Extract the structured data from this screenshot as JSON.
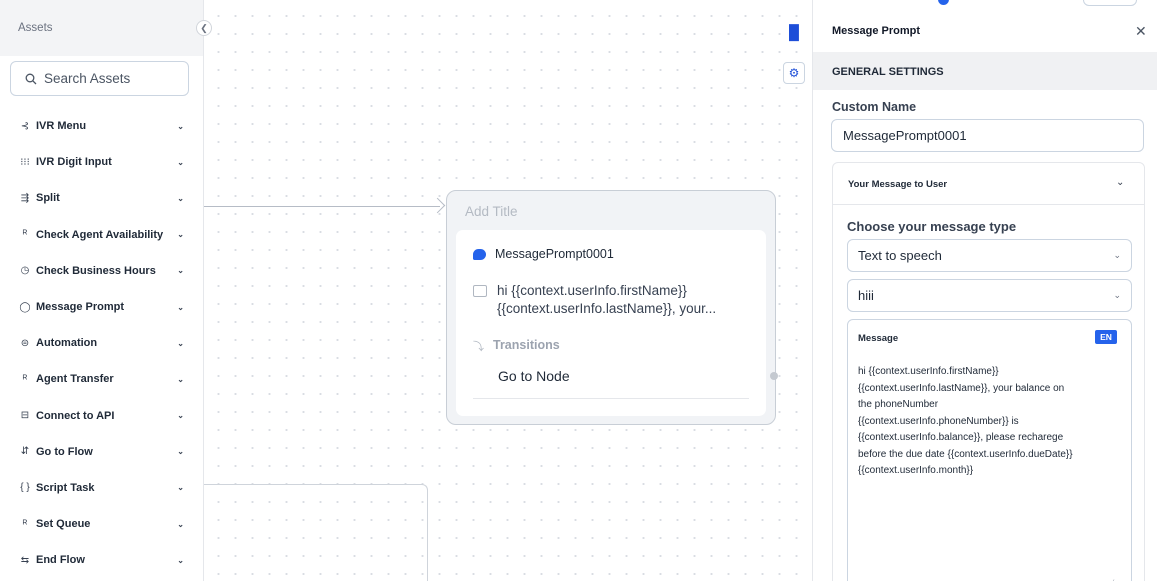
{
  "sidebar": {
    "title": "Assets",
    "collapse_icon": "chevron-left-icon",
    "search_placeholder": "Search Assets",
    "items": [
      {
        "label": "IVR Menu",
        "icon": "ivr-menu-icon",
        "glyph": "⊰"
      },
      {
        "label": "IVR Digit Input",
        "icon": "digit-grid-icon",
        "glyph": "⁝⁝⁝"
      },
      {
        "label": "Split",
        "icon": "split-icon",
        "glyph": "⇶"
      },
      {
        "label": "Check Agent Availability",
        "icon": "agent-icon",
        "glyph": "ᴿ"
      },
      {
        "label": "Check Business Hours",
        "icon": "clock-icon",
        "glyph": "◷"
      },
      {
        "label": "Message Prompt",
        "icon": "message-icon",
        "glyph": "◯"
      },
      {
        "label": "Automation",
        "icon": "automation-icon",
        "glyph": "⊜"
      },
      {
        "label": "Agent Transfer",
        "icon": "agent-transfer-icon",
        "glyph": "ᴿ"
      },
      {
        "label": "Connect to API",
        "icon": "api-icon",
        "glyph": "⊟"
      },
      {
        "label": "Go to Flow",
        "icon": "flow-icon",
        "glyph": "⇵"
      },
      {
        "label": "Script Task",
        "icon": "script-icon",
        "glyph": "{ }"
      },
      {
        "label": "Set Queue",
        "icon": "queue-icon",
        "glyph": "ᴿ"
      },
      {
        "label": "End Flow",
        "icon": "end-flow-icon",
        "glyph": "⇆"
      }
    ]
  },
  "canvas": {
    "node": {
      "title": "Add Title",
      "name": "MessagePrompt0001",
      "message_preview_1": "hi {{context.userInfo.firstName}}",
      "message_preview_2": "{{context.userInfo.lastName}}, your...",
      "transitions_label": "Transitions",
      "goto_label": "Go to Node"
    },
    "tools": {
      "tool1_icon": "hierarchy-icon",
      "tool2_icon": "settings-icon"
    }
  },
  "panel": {
    "title": "Message Prompt",
    "close_icon": "close-icon",
    "section": "GENERAL SETTINGS",
    "custom_name_label": "Custom Name",
    "custom_name_value": "MessagePrompt0001",
    "accordion_title": "Your Message to User",
    "message_type_label": "Choose your message type",
    "message_type_value": "Text to speech",
    "voice_value": "hiii",
    "message_label": "Message",
    "language_badge": "EN",
    "message_lines": [
      "hi {{context.userInfo.firstName}}",
      "{{context.userInfo.lastName}}, your balance on",
      "the phoneNumber",
      "{{context.userInfo.phoneNumber}} is",
      "{{context.userInfo.balance}}, please recharege",
      "before the due date {{context.userInfo.dueDate}}",
      "{{context.userInfo.month}}"
    ]
  },
  "colors": {
    "accent": "#2563eb",
    "panel_section_bg": "#f0f1f3"
  }
}
